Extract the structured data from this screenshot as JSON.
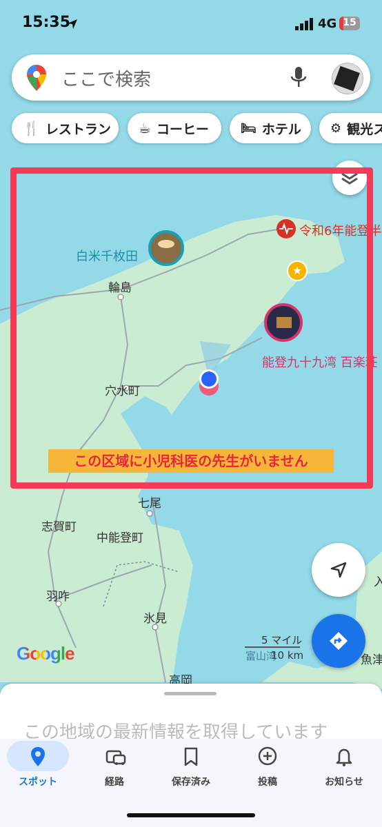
{
  "status": {
    "time": "15:35",
    "network": "4G",
    "battery": "15"
  },
  "search": {
    "placeholder": "ここで検索"
  },
  "chips": [
    "レストラン",
    "コーヒー",
    "ホテル",
    "観光ス"
  ],
  "map": {
    "places": {
      "shiroyone": "白米千枚田",
      "wajima": "輪島",
      "anamizu": "穴水町",
      "nanao": "七尾",
      "shika": "志賀町",
      "nakanoto": "中能登町",
      "hakui": "羽咋",
      "himi": "氷見",
      "takaoka": "高岡",
      "tsukumo": "能登九十九湾 百楽荘",
      "quake": "令和6年能登半",
      "bay": "富山湾",
      "uozu": "魚津",
      "edge": "入"
    },
    "scale": {
      "miles": "5 マイル",
      "km": "10 km"
    },
    "google": "Google",
    "banner": "この区域に小児科医の先生がいません"
  },
  "sheet": {
    "text": "この地域の最新情報を取得しています"
  },
  "nav": [
    "スポット",
    "経路",
    "保存済み",
    "投稿",
    "お知らせ"
  ],
  "colors": {
    "accent": "#1a73e8",
    "frame": "#f43a55",
    "banner": "#f5b63a",
    "land": "#c9ecd3",
    "water": "#93d9e8"
  }
}
